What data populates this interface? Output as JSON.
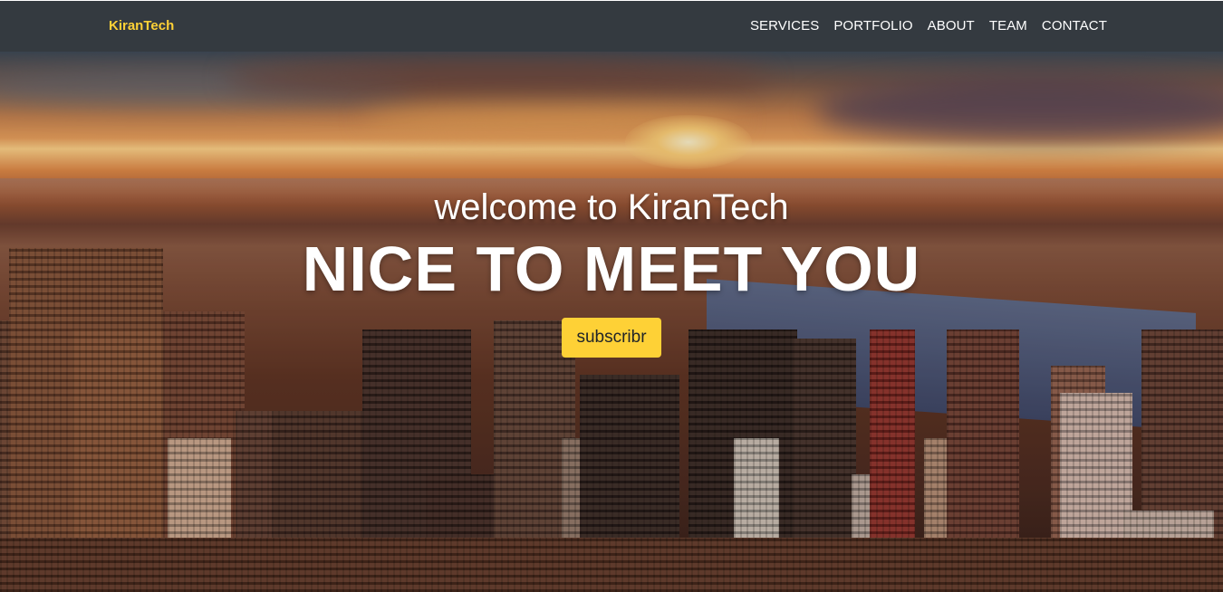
{
  "brand": "KiranTech",
  "nav": {
    "items": [
      "SERVICES",
      "PORTFOLIO",
      "ABOUT",
      "TEAM",
      "CONTACT"
    ]
  },
  "hero": {
    "lead": "welcome to KiranTech",
    "heading": "NICE TO MEET YOU",
    "button_label": "subscribr",
    "background_image": "city-sunset-skyline"
  },
  "colors": {
    "navbar": "#343a40",
    "brand": "#fed136",
    "accent_button": "#fed136",
    "text": "#ffffff"
  }
}
